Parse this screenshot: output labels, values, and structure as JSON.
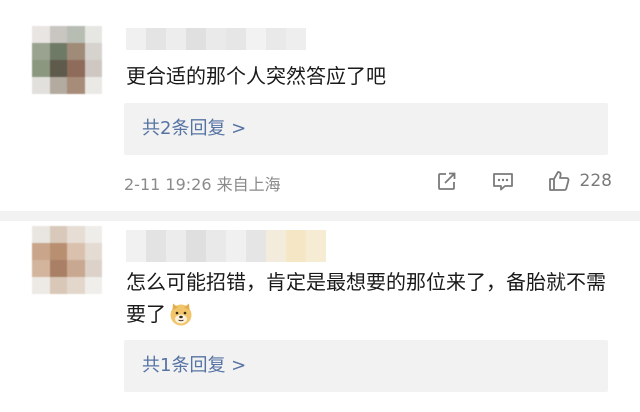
{
  "comments": [
    {
      "text": "更合适的那个人突然答应了吧",
      "reply_link": "共2条回复 >",
      "time": "2-11 19:26",
      "location": "来自上海",
      "like_count": "228"
    },
    {
      "text": "怎么可能招错，肯定是最想要的那位来了，备胎就不需要了",
      "reply_link": "共1条回复 >"
    }
  ],
  "icons": {
    "share": "share-icon",
    "comment": "comment-icon",
    "like": "thumbs-up-icon",
    "emoji": "doge-emoji-icon"
  },
  "colors": {
    "link": "#5573a3",
    "meta": "#8a8a8a",
    "reply_bg": "#f2f2f2"
  }
}
